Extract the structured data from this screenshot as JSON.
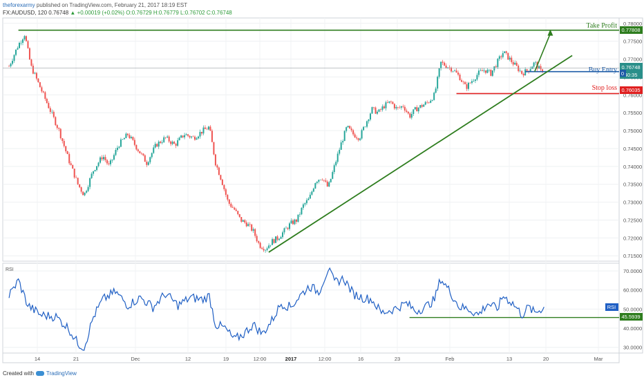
{
  "header": {
    "username": "theforexarmy",
    "published_text": "published on TradingView.com, February 21, 2017 18:19 EST",
    "symbol_line": "FX:AUDUSD, 120",
    "last": "0.76748",
    "change": "▲ +0.00019 (+0.02%)",
    "ohlc": "O:0.76729 H:0.76779 L:0.76702 C:0.76748"
  },
  "footer": {
    "created_with": "Created with",
    "brand": "TradingView"
  },
  "annotations": {
    "take_profit": "Take Profit",
    "buy_entry": "Buy Entry",
    "stop_loss": "Stop loss"
  },
  "axis_badges": {
    "take_profit": "0.77808",
    "current_price": "0.76748",
    "countdown": "40:35",
    "zero_flag": "0",
    "stop_loss": "0.76035",
    "rsi_label": "RSI",
    "rsi_value": "45.5939"
  },
  "colors": {
    "bull": "#26a69a",
    "bear": "#ef5350",
    "trendline": "#2e7d1e",
    "take_profit": "#2e7d1e",
    "buy_entry": "#1b5aa6",
    "stop_loss": "#e02020",
    "rsi_line": "#1f5fc4"
  },
  "chart_data": [
    {
      "type": "candlestick",
      "symbol": "FX:AUDUSD",
      "timeframe": "120",
      "x_tick_labels": [
        "14",
        "21",
        "Dec",
        "12",
        "19",
        "12:00",
        "2017",
        "12:00",
        "16",
        "23",
        "Feb",
        "13",
        "20",
        "Mar"
      ],
      "y_tick_labels": [
        "0.78000",
        "0.77500",
        "0.77000",
        "0.76500",
        "0.76000",
        "0.75500",
        "0.75000",
        "0.74500",
        "0.74000",
        "0.73500",
        "0.73000",
        "0.72500",
        "0.72000",
        "0.71500"
      ],
      "ylim": [
        0.7135,
        0.7815
      ],
      "price_path": [
        {
          "x": 0,
          "price": 0.768
        },
        {
          "x": 3,
          "price": 0.774
        },
        {
          "x": 5,
          "price": 0.777
        },
        {
          "x": 7,
          "price": 0.768
        },
        {
          "x": 9,
          "price": 0.764
        },
        {
          "x": 11,
          "price": 0.76
        },
        {
          "x": 13,
          "price": 0.756
        },
        {
          "x": 16,
          "price": 0.75
        },
        {
          "x": 19,
          "price": 0.742
        },
        {
          "x": 22,
          "price": 0.735
        },
        {
          "x": 24,
          "price": 0.732
        },
        {
          "x": 27,
          "price": 0.739
        },
        {
          "x": 30,
          "price": 0.743
        },
        {
          "x": 32,
          "price": 0.74
        },
        {
          "x": 35,
          "price": 0.746
        },
        {
          "x": 38,
          "price": 0.749
        },
        {
          "x": 41,
          "price": 0.745
        },
        {
          "x": 44,
          "price": 0.741
        },
        {
          "x": 47,
          "price": 0.746
        },
        {
          "x": 50,
          "price": 0.748
        },
        {
          "x": 53,
          "price": 0.746
        },
        {
          "x": 56,
          "price": 0.749
        },
        {
          "x": 59,
          "price": 0.748
        },
        {
          "x": 62,
          "price": 0.75
        },
        {
          "x": 64,
          "price": 0.751
        },
        {
          "x": 66,
          "price": 0.741
        },
        {
          "x": 68,
          "price": 0.736
        },
        {
          "x": 70,
          "price": 0.73
        },
        {
          "x": 72,
          "price": 0.728
        },
        {
          "x": 74,
          "price": 0.725
        },
        {
          "x": 76,
          "price": 0.724
        },
        {
          "x": 78,
          "price": 0.722
        },
        {
          "x": 80,
          "price": 0.718
        },
        {
          "x": 82,
          "price": 0.717
        },
        {
          "x": 84,
          "price": 0.719
        },
        {
          "x": 86,
          "price": 0.72
        },
        {
          "x": 88,
          "price": 0.722
        },
        {
          "x": 90,
          "price": 0.724
        },
        {
          "x": 92,
          "price": 0.725
        },
        {
          "x": 94,
          "price": 0.729
        },
        {
          "x": 96,
          "price": 0.731
        },
        {
          "x": 98,
          "price": 0.736
        },
        {
          "x": 100,
          "price": 0.737
        },
        {
          "x": 102,
          "price": 0.734
        },
        {
          "x": 104,
          "price": 0.74
        },
        {
          "x": 106,
          "price": 0.746
        },
        {
          "x": 108,
          "price": 0.751
        },
        {
          "x": 110,
          "price": 0.749
        },
        {
          "x": 112,
          "price": 0.748
        },
        {
          "x": 114,
          "price": 0.752
        },
        {
          "x": 116,
          "price": 0.756
        },
        {
          "x": 118,
          "price": 0.755
        },
        {
          "x": 120,
          "price": 0.757
        },
        {
          "x": 122,
          "price": 0.758
        },
        {
          "x": 124,
          "price": 0.756
        },
        {
          "x": 126,
          "price": 0.757
        },
        {
          "x": 128,
          "price": 0.754
        },
        {
          "x": 130,
          "price": 0.756
        },
        {
          "x": 132,
          "price": 0.757
        },
        {
          "x": 134,
          "price": 0.758
        },
        {
          "x": 136,
          "price": 0.76
        },
        {
          "x": 138,
          "price": 0.769
        },
        {
          "x": 140,
          "price": 0.768
        },
        {
          "x": 142,
          "price": 0.767
        },
        {
          "x": 144,
          "price": 0.765
        },
        {
          "x": 146,
          "price": 0.762
        },
        {
          "x": 148,
          "price": 0.764
        },
        {
          "x": 150,
          "price": 0.766
        },
        {
          "x": 152,
          "price": 0.767
        },
        {
          "x": 154,
          "price": 0.766
        },
        {
          "x": 156,
          "price": 0.769
        },
        {
          "x": 158,
          "price": 0.772
        },
        {
          "x": 160,
          "price": 0.77
        },
        {
          "x": 162,
          "price": 0.768
        },
        {
          "x": 164,
          "price": 0.766
        },
        {
          "x": 166,
          "price": 0.767
        },
        {
          "x": 168,
          "price": 0.769
        },
        {
          "x": 170,
          "price": 0.7665
        },
        {
          "x": 171,
          "price": 0.7675
        }
      ],
      "trendline": [
        {
          "x": 83,
          "price": 0.716
        },
        {
          "x": 180,
          "price": 0.771
        }
      ],
      "levels": {
        "take_profit": 0.77808,
        "buy_entry": 0.7665,
        "stop_loss": 0.76035,
        "current_price": 0.76748
      },
      "projected_move": [
        {
          "x": 168,
          "price": 0.7665
        },
        {
          "x": 173,
          "price": 0.7779
        }
      ]
    },
    {
      "type": "line",
      "title": "RSI",
      "y_tick_labels": [
        "70.0000",
        "60.0000",
        "50.0000",
        "40.0000",
        "30.0000"
      ],
      "ylim": [
        27,
        74
      ],
      "support_level": 45.5939,
      "current_value": 45.5939,
      "rsi_path": [
        {
          "x": 0,
          "v": 57
        },
        {
          "x": 3,
          "v": 65
        },
        {
          "x": 6,
          "v": 52
        },
        {
          "x": 10,
          "v": 47
        },
        {
          "x": 15,
          "v": 46
        },
        {
          "x": 19,
          "v": 40
        },
        {
          "x": 22,
          "v": 32
        },
        {
          "x": 24,
          "v": 30
        },
        {
          "x": 27,
          "v": 46
        },
        {
          "x": 30,
          "v": 55
        },
        {
          "x": 34,
          "v": 59
        },
        {
          "x": 38,
          "v": 52
        },
        {
          "x": 42,
          "v": 56
        },
        {
          "x": 46,
          "v": 51
        },
        {
          "x": 50,
          "v": 58
        },
        {
          "x": 54,
          "v": 52
        },
        {
          "x": 58,
          "v": 56
        },
        {
          "x": 62,
          "v": 55
        },
        {
          "x": 64,
          "v": 57
        },
        {
          "x": 66,
          "v": 42
        },
        {
          "x": 69,
          "v": 40
        },
        {
          "x": 72,
          "v": 34
        },
        {
          "x": 75,
          "v": 37
        },
        {
          "x": 78,
          "v": 42
        },
        {
          "x": 81,
          "v": 37
        },
        {
          "x": 84,
          "v": 44
        },
        {
          "x": 87,
          "v": 53
        },
        {
          "x": 90,
          "v": 51
        },
        {
          "x": 93,
          "v": 57
        },
        {
          "x": 96,
          "v": 62
        },
        {
          "x": 99,
          "v": 59
        },
        {
          "x": 102,
          "v": 71
        },
        {
          "x": 104,
          "v": 64
        },
        {
          "x": 107,
          "v": 66
        },
        {
          "x": 110,
          "v": 58
        },
        {
          "x": 113,
          "v": 56
        },
        {
          "x": 116,
          "v": 55
        },
        {
          "x": 119,
          "v": 48
        },
        {
          "x": 123,
          "v": 50
        },
        {
          "x": 127,
          "v": 53
        },
        {
          "x": 130,
          "v": 49
        },
        {
          "x": 133,
          "v": 51
        },
        {
          "x": 136,
          "v": 55
        },
        {
          "x": 138,
          "v": 66
        },
        {
          "x": 141,
          "v": 59
        },
        {
          "x": 144,
          "v": 51
        },
        {
          "x": 147,
          "v": 50
        },
        {
          "x": 150,
          "v": 47
        },
        {
          "x": 153,
          "v": 53
        },
        {
          "x": 156,
          "v": 50
        },
        {
          "x": 158,
          "v": 57
        },
        {
          "x": 161,
          "v": 53
        },
        {
          "x": 164,
          "v": 47
        },
        {
          "x": 166,
          "v": 51
        },
        {
          "x": 168,
          "v": 48
        },
        {
          "x": 171,
          "v": 51
        }
      ]
    }
  ]
}
